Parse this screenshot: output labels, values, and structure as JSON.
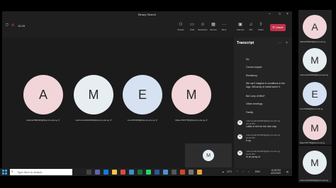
{
  "window": {
    "title": "Binary Search"
  },
  "toolbar": {
    "time": "16:28",
    "buttons": [
      {
        "label": "People",
        "icon": "people-icon"
      },
      {
        "label": "Chat",
        "icon": "chat-icon"
      },
      {
        "label": "Reactions",
        "icon": "reactions-icon"
      },
      {
        "label": "Rooms",
        "icon": "rooms-icon"
      },
      {
        "label": "More",
        "icon": "more-icon"
      },
      {
        "label": "Camera",
        "icon": "camera-icon"
      },
      {
        "label": "Mic",
        "icon": "mic-icon"
      },
      {
        "label": "Share",
        "icon": "share-icon"
      }
    ],
    "leave_label": "Leave"
  },
  "participants": [
    {
      "initial": "A",
      "name": "dawhat7880929@iksp.ks.edu.sg",
      "color": "#f2d5d8"
    },
    {
      "initial": "M",
      "name": "mahmmad1934903@iksp.ks.edu.sg",
      "color": "#e7eef2"
    },
    {
      "initial": "E",
      "name": "irena781380@iksp.ks.edu.sg",
      "color": "#d6e1f2"
    },
    {
      "initial": "M",
      "name": "Mateo7807765@iksp.ks.edu.sg",
      "color": "#f2d5d8"
    }
  ],
  "self_tile": {
    "initial": "M"
  },
  "transcript": {
    "title": "Transcript",
    "lines": [
      "No.",
      "Corona looped.",
      "Residency.",
      "We can't imagine in conditions in the logs. Will array of metal barrel X.",
      "But Larry of Mint?",
      "Other meetings.",
      "Family."
    ],
    "entries": [
      {
        "initial": "M",
        "sender": "mahmmad1934903@iksp.ks.edu.sg",
        "time": "12:11 PM",
        "text": "Label or tell me the nice way."
      },
      {
        "initial": "M",
        "sender": "mahmmad1934903@iksp.ks.edu.sg",
        "time": "12:11 PM",
        "text": "It up."
      },
      {
        "initial": "M",
        "sender": "mahmmad1934903@iksp.ks.edu.sg",
        "time": "12:11 PM",
        "text": "In an array of"
      }
    ]
  },
  "side_gallery": [
    {
      "initial": "A",
      "name": "dawhat7880929@iksp.ks.edu.sg",
      "color": "#f2d5d8"
    },
    {
      "initial": "M",
      "name": "mahmmad1934903@iksp.ks.edu.sg",
      "color": "#e7eef2"
    },
    {
      "initial": "E",
      "name": "irena781380@iksp.ks.edu.sg",
      "color": "#d6e1f2"
    },
    {
      "initial": "M",
      "name": "Mateo7807765@iksp.ks.edu.sg",
      "color": "#f2d5d8"
    },
    {
      "initial": "M",
      "name": "mahmmad1934903@iksp.ks.edu.sg",
      "color": "#e7eef2"
    }
  ],
  "taskbar": {
    "search_placeholder": "Type here to search",
    "weather": "12°C",
    "language": "ENG",
    "time": "10:53 PM",
    "date": "4/21/2022"
  },
  "colors": {
    "leave": "#c4314b",
    "window_bg": "#1f1f1f",
    "transcript_bg": "#242424"
  }
}
